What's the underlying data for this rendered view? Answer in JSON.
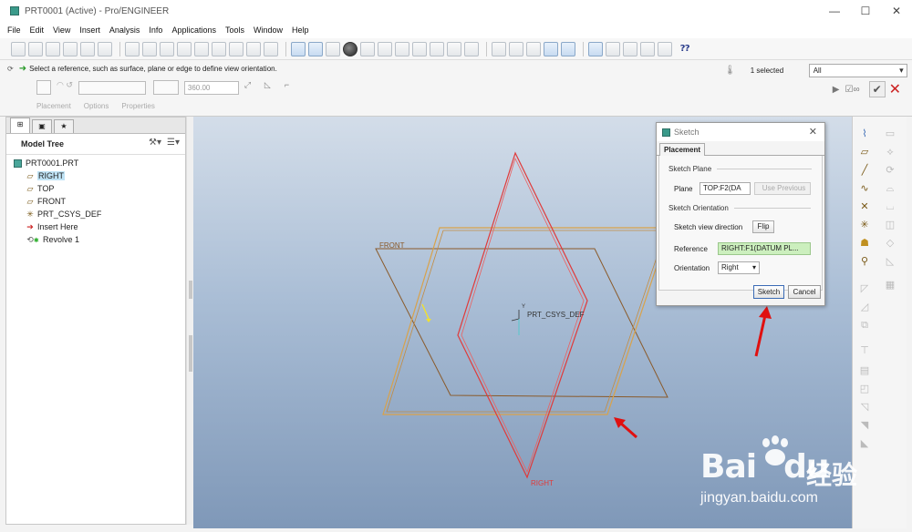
{
  "window": {
    "title": "PRT0001 (Active) - Pro/ENGINEER",
    "minimize": "—",
    "maximize": "☐",
    "close": "✕"
  },
  "menu": {
    "items": [
      "File",
      "Edit",
      "View",
      "Insert",
      "Analysis",
      "Info",
      "Applications",
      "Tools",
      "Window",
      "Help"
    ]
  },
  "toolbar": {
    "help_label": "⁇"
  },
  "dashboard": {
    "message": "Select a reference, such as surface, plane or edge to define view orientation.",
    "angle_value": "360.00",
    "tabs": [
      "Placement",
      "Options",
      "Properties"
    ],
    "selected_count": "1 selected",
    "filter_value": "All"
  },
  "model_tree": {
    "title": "Model Tree",
    "root": "PRT0001.PRT",
    "items": [
      {
        "label": "RIGHT",
        "icon": "datum-plane-icon",
        "selected": true
      },
      {
        "label": "TOP",
        "icon": "datum-plane-icon"
      },
      {
        "label": "FRONT",
        "icon": "datum-plane-icon"
      },
      {
        "label": "PRT_CSYS_DEF",
        "icon": "csys-icon"
      },
      {
        "label": "Insert Here",
        "icon": "insert-arrow-icon"
      },
      {
        "label": "Revolve 1",
        "icon": "revolve-icon"
      }
    ]
  },
  "viewport": {
    "labels": {
      "front": "FRONT",
      "csys": "PRT_CSYS_DEF",
      "right": "RIGHT"
    },
    "colors": {
      "front_plane": "#8a5a2a",
      "top_plane": "#d9a24a",
      "right_plane": "#e03a3a",
      "annotation_arrow": "#e01010"
    }
  },
  "sketch_dialog": {
    "title": "Sketch",
    "tab": "Placement",
    "plane_group": "Sketch Plane",
    "plane_label": "Plane",
    "plane_value": "TOP:F2(DA",
    "use_previous": "Use Previous",
    "orientation_group": "Sketch Orientation",
    "view_direction_label": "Sketch view direction",
    "flip": "Flip",
    "reference_label": "Reference",
    "reference_value": "RIGHT:F1(DATUM PL...",
    "orientation_label": "Orientation",
    "orientation_value": "Right",
    "sketch_button": "Sketch",
    "cancel_button": "Cancel"
  },
  "watermark": {
    "logo": "Bai",
    "logo_tail": "du",
    "chinese": "经验",
    "url": "jingyan.baidu.com"
  }
}
